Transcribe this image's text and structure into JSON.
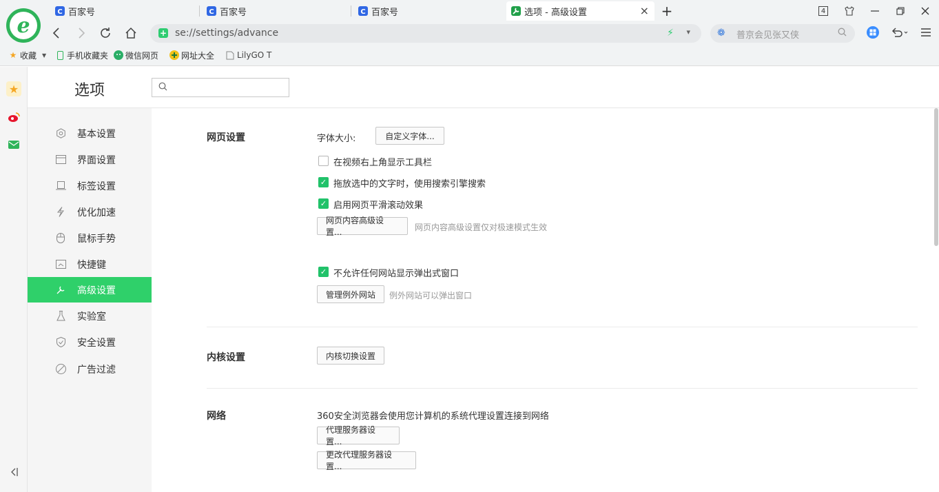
{
  "tabs": [
    {
      "title": "百家号"
    },
    {
      "title": "百家号"
    },
    {
      "title": "百家号"
    },
    {
      "title": "选项 - 高级设置"
    }
  ],
  "window": {
    "tab_count": "4"
  },
  "address": {
    "url": "se://settings/advance"
  },
  "search": {
    "placeholder": "普京会见张又侠"
  },
  "bookmarks": [
    {
      "label": "收藏"
    },
    {
      "label": "手机收藏夹"
    },
    {
      "label": "微信网页"
    },
    {
      "label": "网址大全"
    },
    {
      "label": "LilyGO T"
    }
  ],
  "page": {
    "title": "选项"
  },
  "menu": [
    {
      "label": "基本设置",
      "icon": "gear-icon"
    },
    {
      "label": "界面设置",
      "icon": "window-icon"
    },
    {
      "label": "标签设置",
      "icon": "tab-icon"
    },
    {
      "label": "优化加速",
      "icon": "bolt-icon"
    },
    {
      "label": "鼠标手势",
      "icon": "mouse-icon"
    },
    {
      "label": "快捷键",
      "icon": "keyboard-icon"
    },
    {
      "label": "高级设置",
      "icon": "wrench-icon",
      "active": true
    },
    {
      "label": "实验室",
      "icon": "flask-icon"
    },
    {
      "label": "安全设置",
      "icon": "shield-icon"
    },
    {
      "label": "广告过滤",
      "icon": "block-icon"
    }
  ],
  "web": {
    "section_title": "网页设置",
    "font_size_label": "字体大小:",
    "custom_font_button": "自定义字体...",
    "video_toolbar": {
      "label": "在视频右上角显示工具栏",
      "checked": false
    },
    "drag_search": {
      "label": "拖放选中的文字时，使用搜索引擎搜索",
      "checked": true
    },
    "smooth_scroll": {
      "label": "启用网页平滑滚动效果",
      "checked": true
    },
    "advanced_content_button": "网页内容高级设置...",
    "advanced_content_hint": "网页内容高级设置仅对极速模式生效",
    "block_popups": {
      "label": "不允许任何网站显示弹出式窗口",
      "checked": true
    },
    "manage_exceptions_button": "管理例外网站",
    "manage_exceptions_hint": "例外网站可以弹出窗口"
  },
  "kernel": {
    "section_title": "内核设置",
    "switch_button": "内核切换设置"
  },
  "network": {
    "section_title": "网络",
    "description": "360安全浏览器会使用您计算机的系统代理设置连接到网络",
    "proxy_button": "代理服务器设置...",
    "change_proxy_button": "更改代理服务器设置..."
  },
  "colors": {
    "accent": "#2fd06a",
    "checkbox": "#21c26a",
    "brand": "#2fb45a"
  }
}
